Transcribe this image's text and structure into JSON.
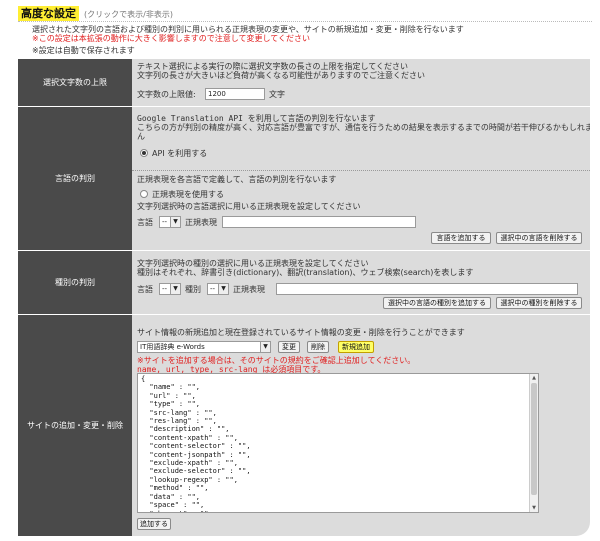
{
  "header": {
    "title": "高度な設定",
    "toggle_hint": "(クリックで表示/非表示)"
  },
  "intro": {
    "line1": "選択された文字列の言語および種別の判別に用いられる正規表現の変更や、サイトの新規追加・変更・削除を行ないます",
    "warning": "※この設定は本拡張の動作に大きく影響しますので注意して変更してください",
    "autosave": "※設定は自動で保存されます"
  },
  "sections": {
    "char_limit": {
      "label": "選択文字数の上限",
      "desc1": "テキスト選択による実行の際に選択文字数の長さの上限を指定してください",
      "desc2": "文字列の長さが大きいほど負荷が高くなる可能性がありますのでご注意ください",
      "field_label": "文字数の上限値:",
      "field_value": "1200",
      "unit": "文字"
    },
    "lang_detect": {
      "label": "言語の判別",
      "api_line": "Google Translation API を利用して言語の判別を行ないます",
      "api_desc1": "こちらの方が判別の精度が高く、対応言語が豊富ですが、通信を行うための結果を表示するまでの時間が若干伸びるかもしれませ",
      "api_desc2": "ん",
      "api_radio": "API を利用する",
      "regex_line": "正規表現を各言語で定義して、言語の判別を行ないます",
      "regex_radio": "正規表現を使用する",
      "regex_desc": "文字列選択時の言語選択に用いる正規表現を設定してください",
      "lang_label": "言語",
      "lang_value": "--",
      "regex_label": "正規表現",
      "regex_value": "",
      "add_button": "言語を追加する",
      "delete_button": "選択中の言語を削除する"
    },
    "type_detect": {
      "label": "種別の判別",
      "desc1": "文字列選択時の種別の選択に用いる正規表現を設定してください",
      "desc2": "種別はそれぞれ、辞書引き(dictionary)、翻訳(translation)、ウェブ検索(search)を表します",
      "lang_label": "言語",
      "lang_value": "--",
      "type_label": "種別",
      "type_value": "--",
      "regex_label": "正規表現",
      "regex_value": "",
      "add_button": "選択中の言語の種別を追加する",
      "delete_button": "選択中の種別を削除する"
    },
    "site_edit": {
      "label": "サイトの追加・変更・削除",
      "desc": "サイト情報の新規追加と現在登録されているサイト情報の変更・削除を行うことができます",
      "site_select": "IT用語辞典 e-Words",
      "change_button": "変更",
      "delete_button": "削除",
      "new_button": "新規追加",
      "warning1": "※サイトを追加する場合は、そのサイトの規約をご確認上追加してください。",
      "warning2": "name, url, type, src-lang は必須項目です。",
      "json_text": "{\n  \"name\" : \"\",\n  \"url\" : \"\",\n  \"type\" : \"\",\n  \"src-lang\" : \"\",\n  \"res-lang\" : \"\",\n  \"description\" : \"\",\n  \"content-xpath\" : \"\",\n  \"content-selector\" : \"\",\n  \"content-jsonpath\" : \"\",\n  \"exclude-xpath\" : \"\",\n  \"exclude-selector\" : \"\",\n  \"lookup-regexp\" : \"\",\n  \"method\" : \"\",\n  \"data\" : \"\",\n  \"space\" : \"\",\n  \"charset\" : \"\"",
      "submit_button": "追加する"
    }
  }
}
